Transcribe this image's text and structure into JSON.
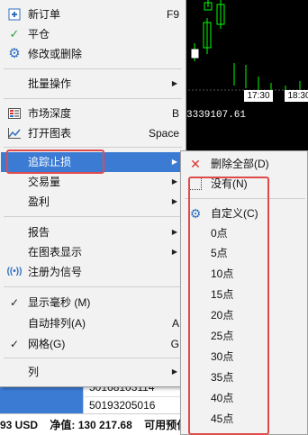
{
  "chart": {
    "times": [
      "17:30",
      "18:30"
    ],
    "price_text": "3339107.61",
    "colors": {
      "background": "#000000",
      "candle": "#00ff00"
    }
  },
  "table": {
    "rows": [
      "50168103114",
      "50193205016"
    ]
  },
  "status": {
    "items": [
      "93 USD",
      "净值: 130 217.68",
      "可用预付"
    ]
  },
  "main_menu": {
    "items": [
      {
        "label": "新订单",
        "shortcut": "F9",
        "icon": "new-order-icon"
      },
      {
        "label": "平仓",
        "shortcut": "",
        "icon": "check-icon"
      },
      {
        "label": "修改或删除",
        "shortcut": "",
        "icon": "gear-icon"
      },
      {
        "label": "批量操作",
        "shortcut": "",
        "icon": ""
      },
      {
        "label": "市场深度",
        "shortcut": "B",
        "icon": "depth-icon"
      },
      {
        "label": "打开图表",
        "shortcut": "Space",
        "icon": "chart-icon"
      },
      {
        "label": "追踪止损",
        "shortcut": "",
        "icon": ""
      },
      {
        "label": "交易量",
        "shortcut": "",
        "icon": ""
      },
      {
        "label": "盈利",
        "shortcut": "",
        "icon": ""
      },
      {
        "label": "报告",
        "shortcut": "",
        "icon": ""
      },
      {
        "label": "在图表显示",
        "shortcut": "",
        "icon": ""
      },
      {
        "label": "注册为信号",
        "shortcut": "",
        "icon": "signal-icon"
      },
      {
        "label": "显示毫秒 (M)",
        "shortcut": "",
        "icon": "check-icon"
      },
      {
        "label": "自动排列(A)",
        "shortcut": "A",
        "icon": ""
      },
      {
        "label": "网格(G)",
        "shortcut": "G",
        "icon": "check-icon"
      },
      {
        "label": "列",
        "shortcut": "",
        "icon": ""
      }
    ]
  },
  "sub_menu": {
    "items": [
      {
        "label": "删除全部(D)",
        "icon": "delete-icon"
      },
      {
        "label": "没有(N)",
        "icon": "checkbox-icon"
      },
      {
        "label": "自定义(C)",
        "icon": "gear-icon"
      },
      {
        "label": "0点"
      },
      {
        "label": "5点"
      },
      {
        "label": "10点"
      },
      {
        "label": "15点"
      },
      {
        "label": "20点"
      },
      {
        "label": "25点"
      },
      {
        "label": "30点"
      },
      {
        "label": "35点"
      },
      {
        "label": "40点"
      },
      {
        "label": "45点"
      }
    ]
  }
}
